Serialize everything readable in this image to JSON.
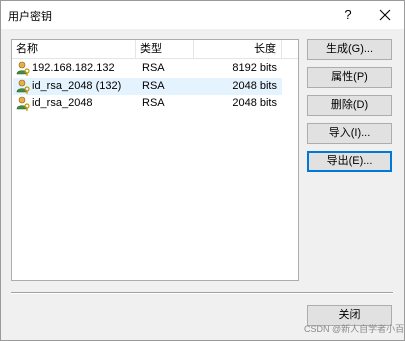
{
  "window": {
    "title": "用户密钥",
    "help_label": "?",
    "close_icon": "close-icon"
  },
  "list": {
    "columns": [
      "名称",
      "类型",
      "长度"
    ],
    "rows": [
      {
        "name": "192.168.182.132",
        "type": "RSA",
        "length": "8192 bits",
        "icon": "user-key-icon",
        "selected": false
      },
      {
        "name": "id_rsa_2048 (132)",
        "type": "RSA",
        "length": "2048 bits",
        "icon": "user-key-icon",
        "selected": true
      },
      {
        "name": "id_rsa_2048",
        "type": "RSA",
        "length": "2048 bits",
        "icon": "user-key-icon",
        "selected": false
      }
    ]
  },
  "buttons": {
    "generate": "生成(G)...",
    "properties": "属性(P)",
    "delete": "删除(D)",
    "import": "导入(I)...",
    "export": "导出(E)...",
    "close": "关闭"
  },
  "watermark": "CSDN @新人自学者小百",
  "colors": {
    "selection": "#e5f3ff",
    "focus": "#0078d7",
    "button_face": "#e1e1e1"
  }
}
